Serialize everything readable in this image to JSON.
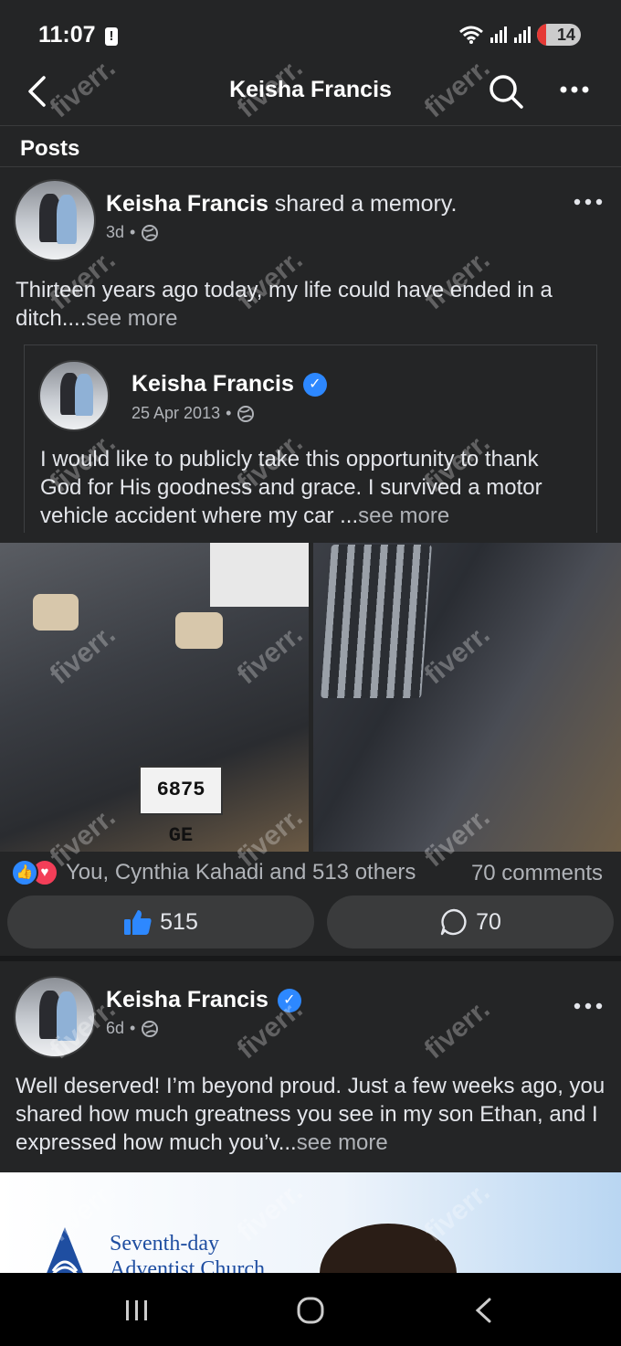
{
  "status_bar": {
    "time": "11:07",
    "alert": "!",
    "battery": "14"
  },
  "header": {
    "title": "Keisha Francis"
  },
  "section": {
    "label": "Posts"
  },
  "post1": {
    "author": "Keisha Francis",
    "action": " shared a memory.",
    "time": "3d",
    "text": "Thirteen years ago today, my life could have ended in a ditch....",
    "see_more": "see more",
    "shared": {
      "author": "Keisha Francis",
      "date": "25 Apr 2013",
      "text": "I would like to publicly take this opportunity to thank God for His goodness and grace. I survived a motor vehicle accident where my car ...",
      "see_more": "see more"
    },
    "photo_plate": "6875 GE",
    "reactions_text": "You, Cynthia Kahadi and 513 others",
    "comments_text": "70 comments",
    "like_count": "515",
    "comment_count": "70"
  },
  "post2": {
    "author": "Keisha Francis",
    "time": "6d",
    "text": "Well deserved! I’m beyond proud. Just a few weeks ago, you shared how much greatness you see in my son Ethan, and I expressed how much you’v...",
    "see_more": "see more",
    "banner_line1": "Seventh-day",
    "banner_line2": "Adventist Church"
  },
  "watermark": "fiverr.",
  "colors": {
    "accent": "#2d88ff",
    "love": "#f33e58",
    "background": "#242526"
  }
}
